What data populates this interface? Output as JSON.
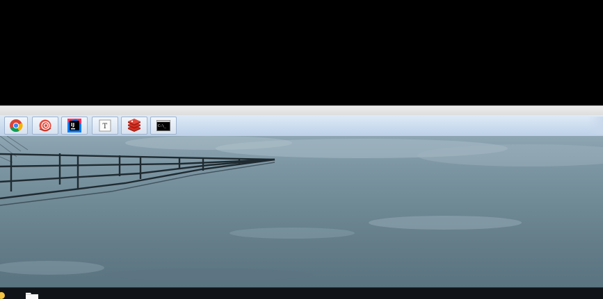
{
  "screen": {
    "top_area": "black",
    "colors": {
      "launcher_bg": "#cfdff0",
      "wallpaper_water": "#6f8995",
      "taskbar_bg": "#101418"
    }
  },
  "launcher": {
    "items": [
      {
        "name": "chrome",
        "icon": "chrome-icon"
      },
      {
        "name": "snail",
        "icon": "snail-icon"
      },
      {
        "name": "intellij-idea",
        "icon": "intellij-icon",
        "text": "IJ"
      },
      {
        "name": "text-editor",
        "icon": "text-editor-icon",
        "text": "T"
      },
      {
        "name": "redis",
        "icon": "redis-icon"
      },
      {
        "name": "terminal",
        "icon": "terminal-icon",
        "text": "C:\\_"
      }
    ]
  },
  "wallpaper": {
    "description_icon": "lake-pier-wallpaper"
  },
  "taskbar": {
    "items": [
      {
        "icon": "start-icon"
      },
      {
        "icon": "file-explorer-icon"
      }
    ]
  }
}
